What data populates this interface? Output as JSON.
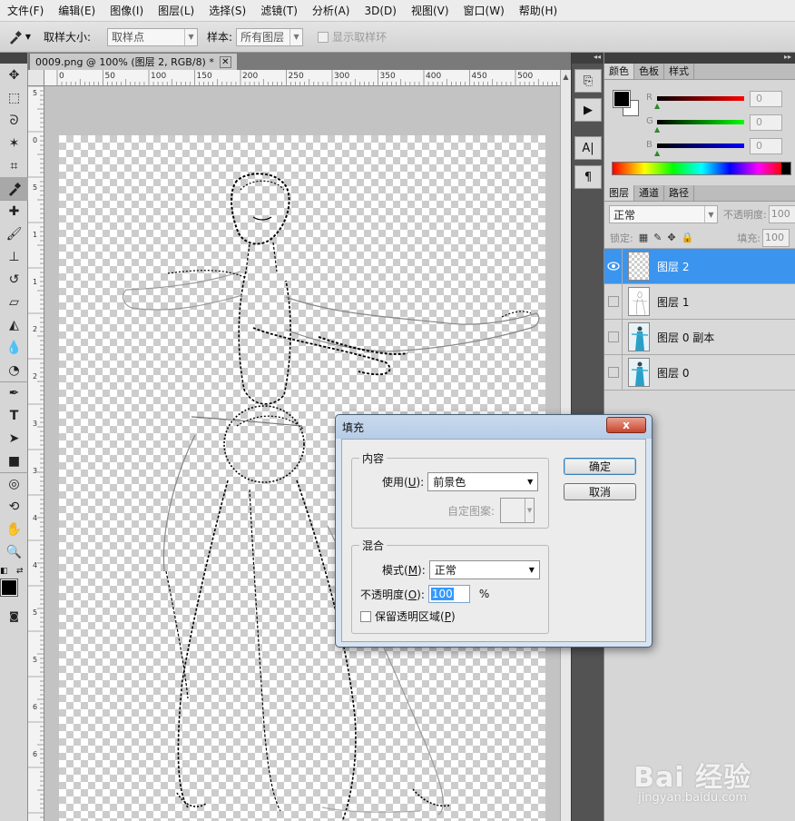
{
  "menu": [
    "文件(F)",
    "编辑(E)",
    "图像(I)",
    "图层(L)",
    "选择(S)",
    "滤镜(T)",
    "分析(A)",
    "3D(D)",
    "视图(V)",
    "窗口(W)",
    "帮助(H)"
  ],
  "options_bar": {
    "sample_size_label": "取样大小:",
    "sample_size_value": "取样点",
    "sample_label": "样本:",
    "sample_value": "所有图层",
    "show_ring_label": "显示取样环"
  },
  "document": {
    "tab_title": "0009.png @ 100% (图层 2, RGB/8) *",
    "ruler_h": [
      "0",
      "50",
      "100",
      "150",
      "200",
      "250",
      "300",
      "350",
      "400",
      "450",
      "500"
    ],
    "ruler_v": [
      "5",
      "0",
      "5",
      "1",
      "1",
      "2",
      "2",
      "3",
      "3",
      "4",
      "4",
      "5",
      "5",
      "6",
      "6"
    ]
  },
  "color_panel": {
    "tabs": [
      "颜色",
      "色板",
      "样式"
    ],
    "r_label": "R",
    "g_label": "G",
    "b_label": "B",
    "r_value": "0",
    "g_value": "0",
    "b_value": "0",
    "foreground": "#000000",
    "background": "#ffffff"
  },
  "layers_panel": {
    "tabs": [
      "图层",
      "通道",
      "路径"
    ],
    "blend_mode": "正常",
    "opacity_label": "不透明度:",
    "opacity_value": "100",
    "lock_label": "锁定:",
    "fill_label": "填充:",
    "fill_value": "100",
    "layers": [
      {
        "name": "图层 2",
        "selected": true,
        "visible": true
      },
      {
        "name": "图层 1",
        "selected": false,
        "visible": false
      },
      {
        "name": "图层 0 副本",
        "selected": false,
        "visible": false
      },
      {
        "name": "图层 0",
        "selected": false,
        "visible": false
      }
    ]
  },
  "dialog": {
    "title": "填充",
    "close_label": "x",
    "content_group": "内容",
    "use_label_pre": "使用(",
    "use_label_key": "U",
    "use_label_post": "):",
    "use_value": "前景色",
    "custom_pattern_label": "自定图案:",
    "blend_group": "混合",
    "mode_label_pre": "模式(",
    "mode_label_key": "M",
    "mode_label_post": "):",
    "mode_value": "正常",
    "opacity_label_pre": "不透明度(",
    "opacity_label_key": "O",
    "opacity_label_post": "):",
    "opacity_value": "100",
    "percent": "%",
    "preserve_label_pre": "保留透明区域(",
    "preserve_label_key": "P",
    "preserve_label_post": ")",
    "ok": "确定",
    "cancel": "取消"
  },
  "watermark": {
    "brand": "Bai 经验",
    "url": "jingyan.baidu.com"
  }
}
